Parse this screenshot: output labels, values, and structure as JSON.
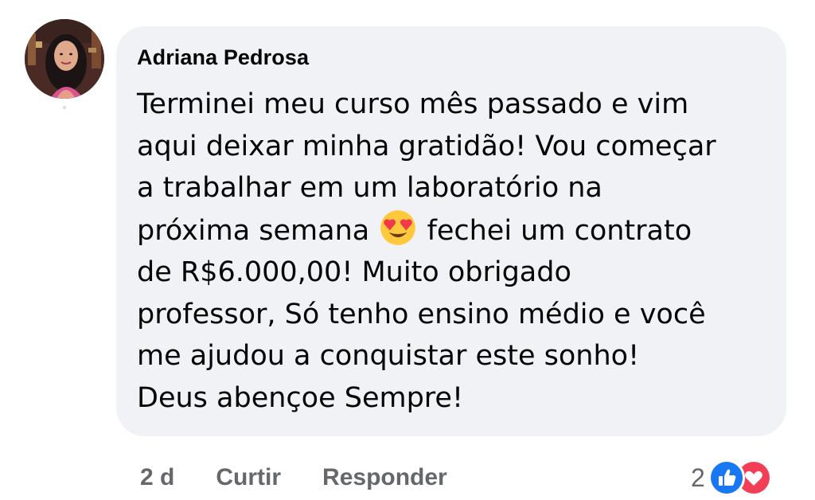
{
  "comment": {
    "author": "Adriana Pedrosa",
    "lines": [
      "Terminei meu curso mês passado e vim",
      "aqui deixar minha gratidão! Vou começar",
      "a trabalhar em um laboratório na",
      "próxima semana",
      "fechei um contrato",
      "de R$6.000,00! Muito obrigado",
      "professor, Só tenho ensino médio e você",
      "me ajudou a conquistar este sonho!",
      "Deus abençoe Sempre!"
    ],
    "emoji": "heart-eyes-emoji"
  },
  "actions": {
    "time": "2 d",
    "like_label": "Curtir",
    "reply_label": "Responder"
  },
  "reactions": {
    "count": "2",
    "icons": [
      "like-reaction-icon",
      "love-reaction-icon"
    ],
    "colors": {
      "like": "#1877f2",
      "love": "#f33e58"
    }
  },
  "colors": {
    "bubble": "#f0f2f5",
    "text": "#050505",
    "secondary": "#65676b"
  }
}
